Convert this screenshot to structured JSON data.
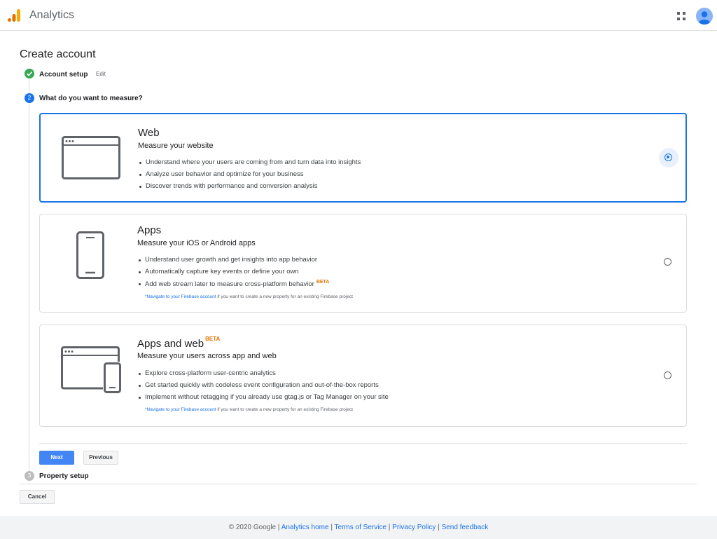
{
  "header": {
    "app_title": "Analytics",
    "logo_icon": "analytics-logo-icon",
    "apps_icon": "apps-grid-icon",
    "avatar_icon": "account-avatar-icon",
    "brand_colors": [
      "#f9ab00",
      "#e37400"
    ]
  },
  "page": {
    "title": "Create account"
  },
  "steps": [
    {
      "number": "✓",
      "label": "Account setup",
      "status": "complete",
      "edit_label": "Edit"
    },
    {
      "number": "2",
      "label": "What do you want to measure?",
      "status": "active"
    },
    {
      "number": "3",
      "label": "Property setup",
      "status": "pending"
    }
  ],
  "options": {
    "web": {
      "title": "Web",
      "subtitle": "Measure your website",
      "bullets": [
        "Understand where your users are coming from and turn data into insights",
        "Analyze user behavior and optimize for your business",
        "Discover trends with performance and conversion analysis"
      ],
      "selected": true,
      "icon": "browser-window-icon"
    },
    "apps": {
      "title": "Apps",
      "subtitle": "Measure your iOS or Android apps",
      "bullets": [
        "Understand user growth and get insights into app behavior",
        "Automatically capture key events or define your own",
        "Add web stream later to measure cross-platform behavior"
      ],
      "beta_label": "BETA",
      "note_link": "*Navigate to your Firebase account",
      "note_text": " if you want to create a new property for an existing Firebase project",
      "selected": false,
      "icon": "mobile-phone-icon"
    },
    "apps_and_web": {
      "title": "Apps and web",
      "title_badge": "BETA",
      "subtitle": "Measure your users across app and web",
      "bullets": [
        "Explore cross-platform user-centric analytics",
        "Get started quickly with codeless event configuration and out-of-the-box reports",
        "Implement without retagging if you already use gtag.js or Tag Manager on your site"
      ],
      "note_link": "*Navigate to your Firebase account",
      "note_text": " if you want to create a new property for an existing Firebase project",
      "selected": false,
      "icon": "browser-and-phone-icon"
    }
  },
  "buttons": {
    "next": "Next",
    "previous": "Previous",
    "cancel": "Cancel"
  },
  "footer": {
    "copyright": "© 2020 Google",
    "links": [
      "Analytics home",
      "Terms of Service",
      "Privacy Policy",
      "Send feedback"
    ]
  },
  "colors": {
    "accent": "#1a73e8",
    "primary_button": "#4285f4",
    "success": "#34a853",
    "beta": "#e37400"
  }
}
